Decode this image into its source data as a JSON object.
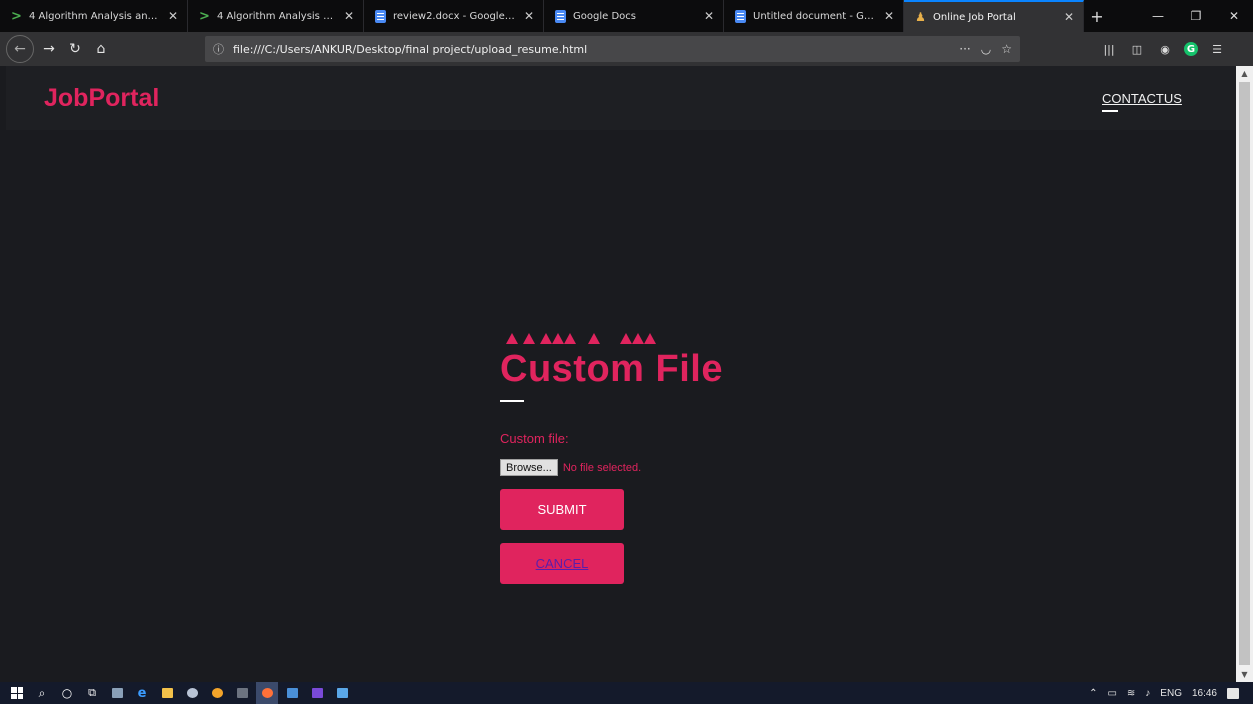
{
  "browser": {
    "tabs": [
      {
        "title": "4 Algorithm Analysis and Desi",
        "icon": "green-arrow-icon",
        "active": false
      },
      {
        "title": "4 Algorithm Analysis and Desi",
        "icon": "green-arrow-icon",
        "active": false
      },
      {
        "title": "review2.docx - Google Docs",
        "icon": "google-docs-icon",
        "active": false
      },
      {
        "title": "Google Docs",
        "icon": "google-docs-icon",
        "active": false
      },
      {
        "title": "Untitled document - Google D",
        "icon": "google-docs-icon",
        "active": false
      },
      {
        "title": "Online Job Portal",
        "icon": "person-icon",
        "active": true
      }
    ],
    "url": "file:///C:/Users/ANKUR/Desktop/final project/upload_resume.html"
  },
  "page": {
    "brand": "JobPortal",
    "nav": {
      "contact": "CONTACTUS"
    },
    "heading": "Custom File",
    "file_label": "Custom file:",
    "browse_label": "Browse...",
    "file_status": "No file selected.",
    "submit_label": "SUBMIT",
    "cancel_label": "CANCEL"
  },
  "taskbar": {
    "tray": {
      "language": "ENG",
      "time": "16:46"
    }
  },
  "colors": {
    "accent": "#e0245e",
    "page_bg": "#1a1b1f",
    "browser_toolbar": "#323234",
    "taskbar": "#141a2b"
  }
}
